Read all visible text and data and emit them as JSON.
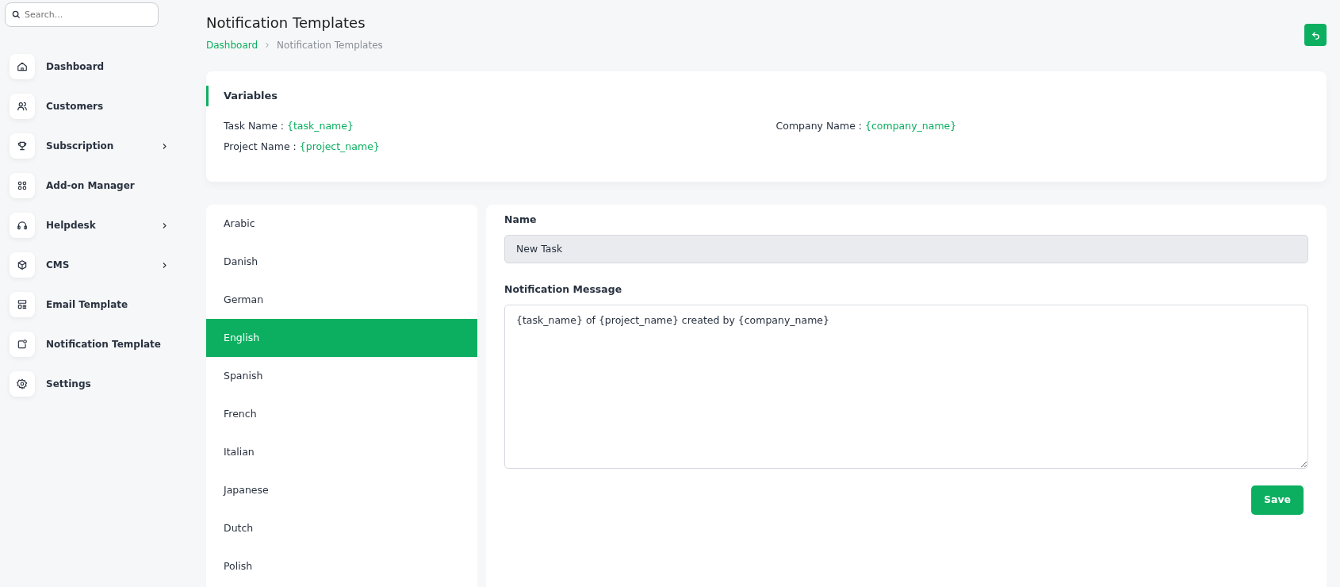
{
  "sidebar": {
    "search": {
      "placeholder": "Search..."
    },
    "items": [
      {
        "label": "Dashboard",
        "has_submenu": false
      },
      {
        "label": "Customers",
        "has_submenu": false
      },
      {
        "label": "Subscription",
        "has_submenu": true
      },
      {
        "label": "Add-on Manager",
        "has_submenu": false
      },
      {
        "label": "Helpdesk",
        "has_submenu": true
      },
      {
        "label": "CMS",
        "has_submenu": true
      },
      {
        "label": "Email Template",
        "has_submenu": false
      },
      {
        "label": "Notification Template",
        "has_submenu": false
      },
      {
        "label": "Settings",
        "has_submenu": false
      }
    ]
  },
  "header": {
    "title": "Notification Templates",
    "breadcrumb": [
      "Dashboard",
      "Notification Templates"
    ]
  },
  "variables": {
    "title": "Variables",
    "columns": [
      [
        {
          "label": "Task Name :",
          "value": "{task_name}"
        },
        {
          "label": "Project Name :",
          "value": "{project_name}"
        }
      ],
      [
        {
          "label": "Company Name :",
          "value": "{company_name}"
        }
      ]
    ]
  },
  "languages": [
    {
      "label": "Arabic",
      "selected": false
    },
    {
      "label": "Danish",
      "selected": false
    },
    {
      "label": "German",
      "selected": false
    },
    {
      "label": "English",
      "selected": true
    },
    {
      "label": "Spanish",
      "selected": false
    },
    {
      "label": "French",
      "selected": false
    },
    {
      "label": "Italian",
      "selected": false
    },
    {
      "label": "Japanese",
      "selected": false
    },
    {
      "label": "Dutch",
      "selected": false
    },
    {
      "label": "Polish",
      "selected": false
    }
  ],
  "form": {
    "name_label": "Name",
    "name_value": "New Task",
    "message_label": "Notification Message",
    "message_value": "{task_name} of {project_name} created by {company_name}",
    "save": "Save"
  }
}
